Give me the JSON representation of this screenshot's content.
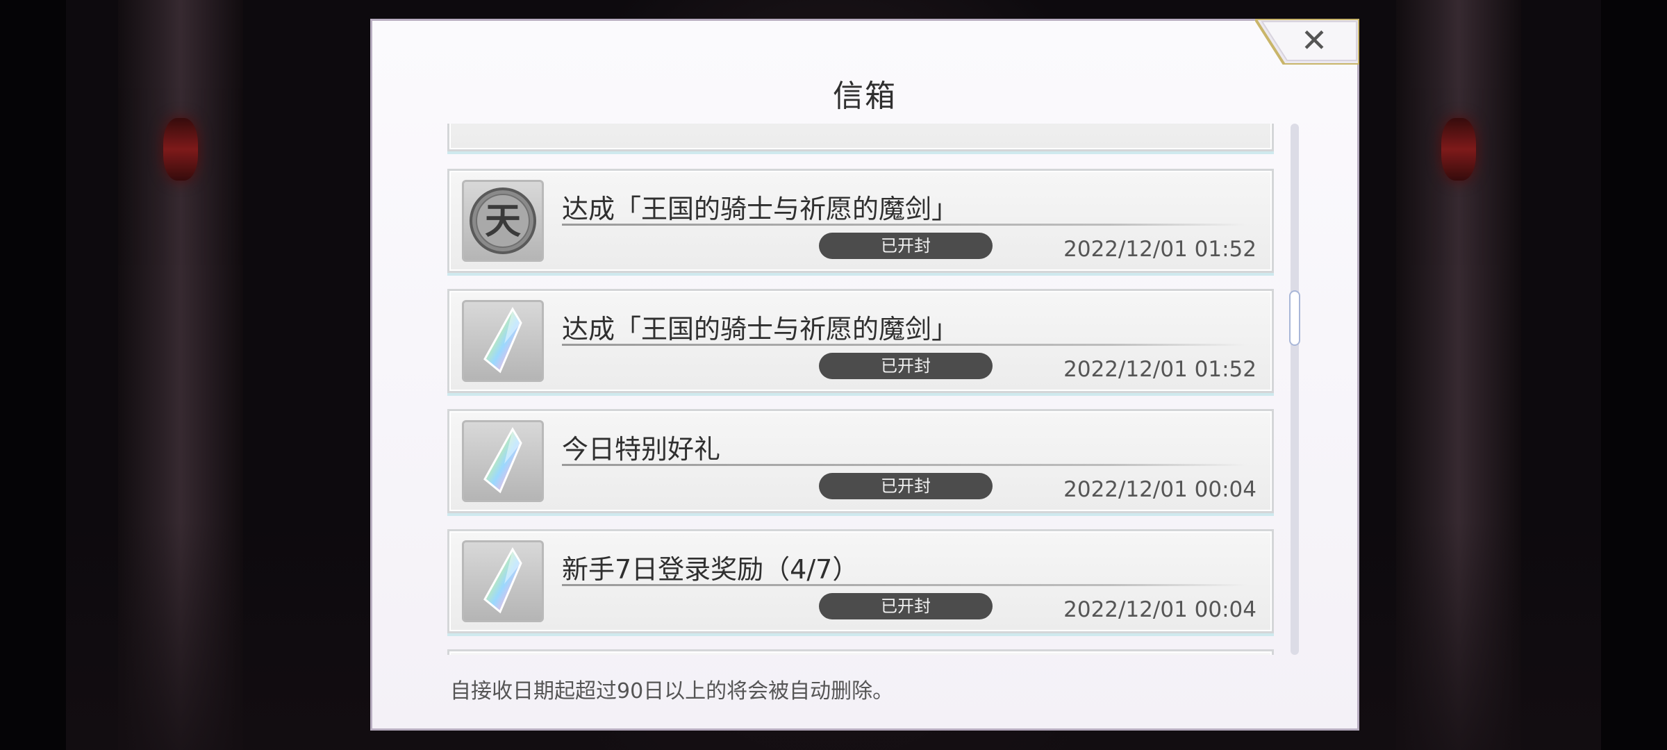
{
  "modal": {
    "title": "信箱",
    "close_symbol": "✕",
    "footer_note": "自接收日期起超过90日以上的将会被自动删除。"
  },
  "mail_list": {
    "items": [
      {
        "icon": "heaven-medal-icon",
        "title": "达成「王国的骑士与祈愿的魔剑」",
        "status": "已开封",
        "date": "2022/12/01 01:52"
      },
      {
        "icon": "rainbow-crystal-icon",
        "title": "达成「王国的骑士与祈愿的魔剑」",
        "status": "已开封",
        "date": "2022/12/01 01:52"
      },
      {
        "icon": "rainbow-crystal-icon",
        "title": "今日特别好礼",
        "status": "已开封",
        "date": "2022/12/01 00:04"
      },
      {
        "icon": "rainbow-crystal-icon",
        "title": "新手7日登录奖励（4/7）",
        "status": "已开封",
        "date": "2022/12/01 00:04"
      }
    ],
    "medal_glyph": "天"
  },
  "scrollbar": {
    "position_fraction": 0.35
  }
}
